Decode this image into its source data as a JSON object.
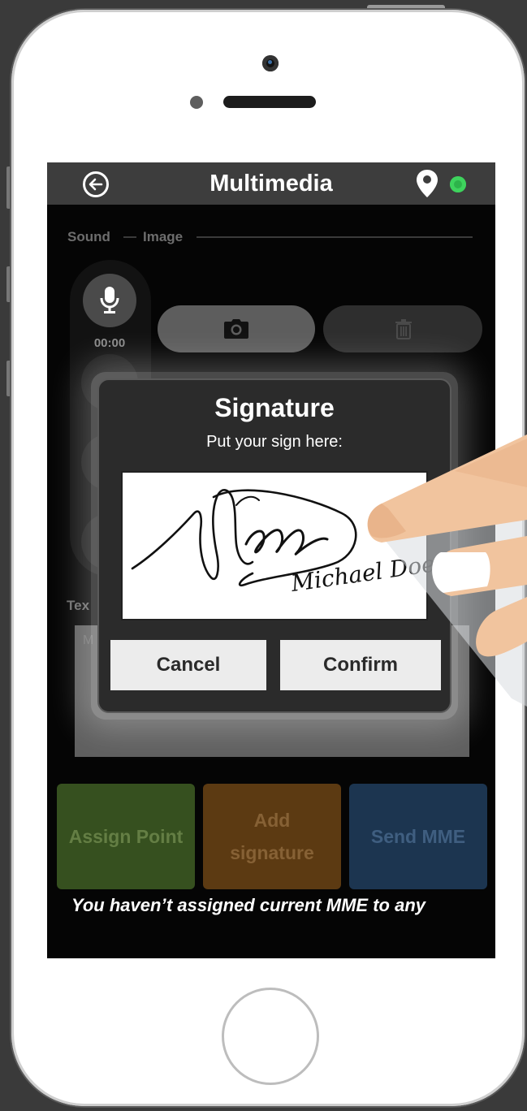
{
  "header": {
    "title": "Multimedia"
  },
  "tabs": {
    "sound": "Sound",
    "image": "Image"
  },
  "audio": {
    "timer": "00:00"
  },
  "text_section": {
    "label": "Tex",
    "placeholder": "M"
  },
  "actions": {
    "assign_point": "Assign Point",
    "add_signature_line1": "Add",
    "add_signature_line2": "signature",
    "send_mme": "Send MME"
  },
  "notice": "You haven’t assigned current MME to any",
  "dialog": {
    "title": "Signature",
    "subtitle": "Put your sign here:",
    "signature_text": "Michael Doe",
    "cancel_label": "Cancel",
    "confirm_label": "Confirm"
  },
  "colors": {
    "assign": "#36501f",
    "add_signature": "#5c3a12",
    "send": "#1c3550",
    "status_online": "#2db34a",
    "topbar": "#3d3d3d"
  },
  "icons": [
    "back-arrow-icon",
    "location-pin-icon",
    "status-dot-icon",
    "microphone-icon",
    "camera-icon",
    "trash-icon"
  ]
}
